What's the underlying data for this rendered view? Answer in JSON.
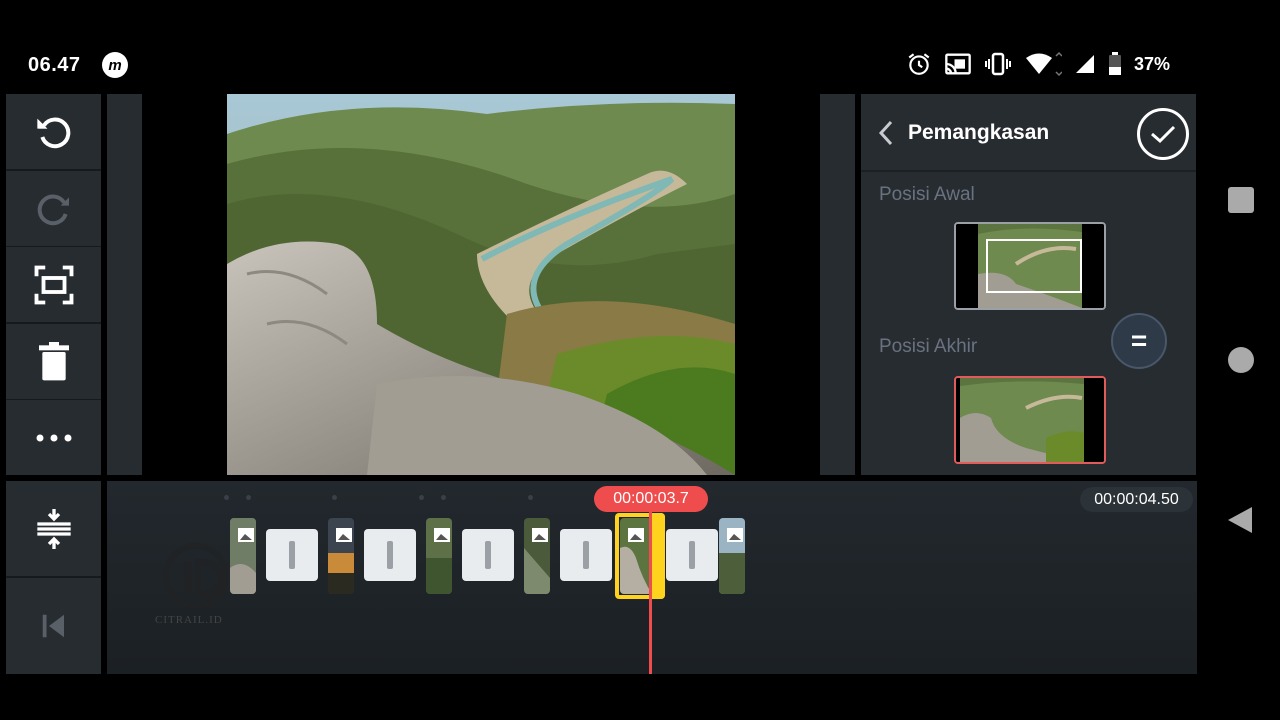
{
  "status_bar": {
    "time": "06.47",
    "app_logo": "m",
    "battery": "37%",
    "icons": [
      "alarm-icon",
      "cast-icon",
      "vibrate-icon",
      "wifi-icon",
      "signal-icon",
      "battery-icon"
    ]
  },
  "toolbar": {
    "items": [
      "undo-icon",
      "redo-icon",
      "crop-fit-icon",
      "delete-icon",
      "more-icon"
    ],
    "bottom_items": [
      "expand-timeline-icon",
      "skip-to-start-icon"
    ]
  },
  "trim_panel": {
    "title": "Pemangkasan",
    "start_label": "Posisi Awal",
    "end_label": "Posisi Akhir",
    "swap_symbol": "="
  },
  "timeline": {
    "current_time": "00:00:03.7",
    "total_time": "00:00:04.50"
  },
  "watermark": {
    "text": "CITRAIL.ID"
  },
  "colors": {
    "accent_red": "#ef4d4d",
    "selection_yellow": "#ffd21e",
    "panel": "#272c31"
  }
}
